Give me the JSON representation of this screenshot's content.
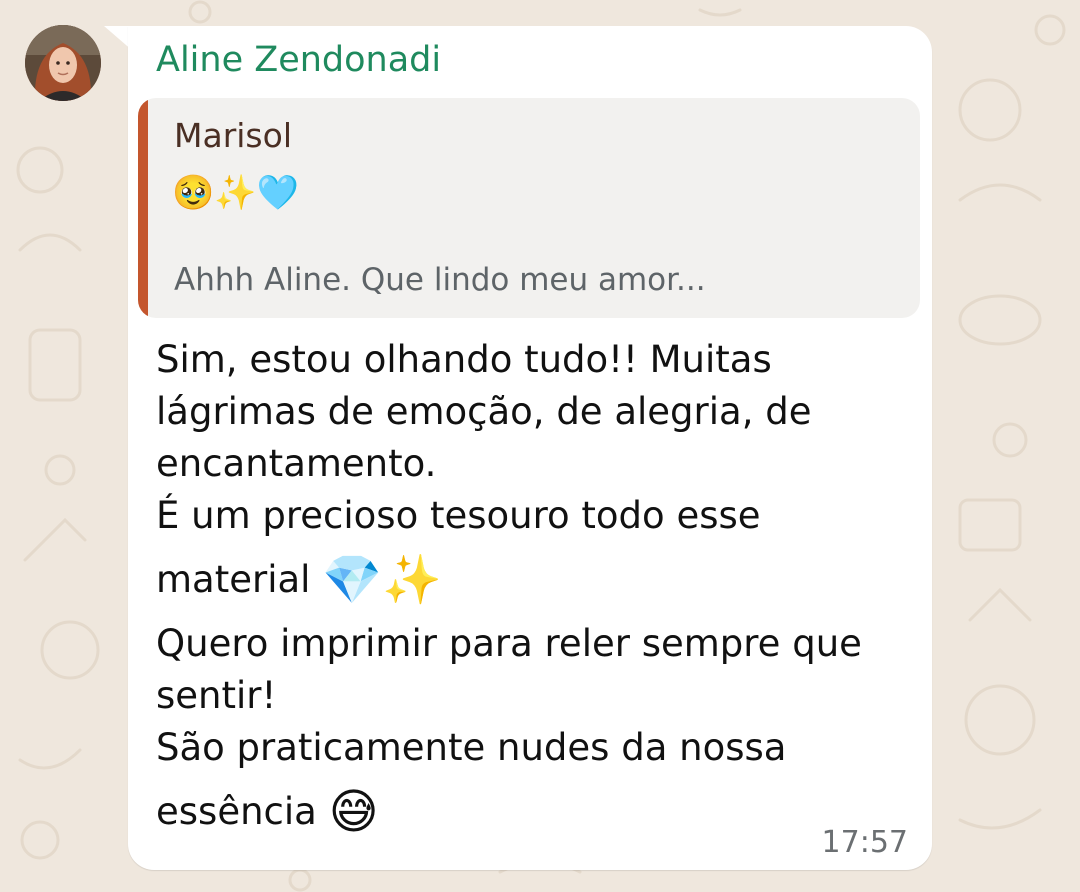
{
  "chat": {
    "sender_name": "Aline Zendonadi",
    "quoted": {
      "author": "Marisol",
      "emoji_line": "🥹✨🩵",
      "preview": "Ahhh Aline. Que lindo meu amor..."
    },
    "message_lines": [
      "Sim, estou olhando tudo!! Muitas",
      "lágrimas de emoção, de alegria, de",
      "encantamento.",
      "É um precioso tesouro todo esse",
      "material",
      "Quero imprimir para reler sempre que",
      "sentir!",
      "São praticamente nudes da nossa",
      "essência"
    ],
    "inline_emojis": {
      "material": "💎✨",
      "essencia": "😅"
    },
    "timestamp": "17:57"
  },
  "colors": {
    "background": "#efe7dd",
    "bubble": "#ffffff",
    "sender_name": "#1f8a5e",
    "quote_bar": "#c4562d"
  },
  "icons": {
    "avatar": "user-avatar-photo"
  }
}
